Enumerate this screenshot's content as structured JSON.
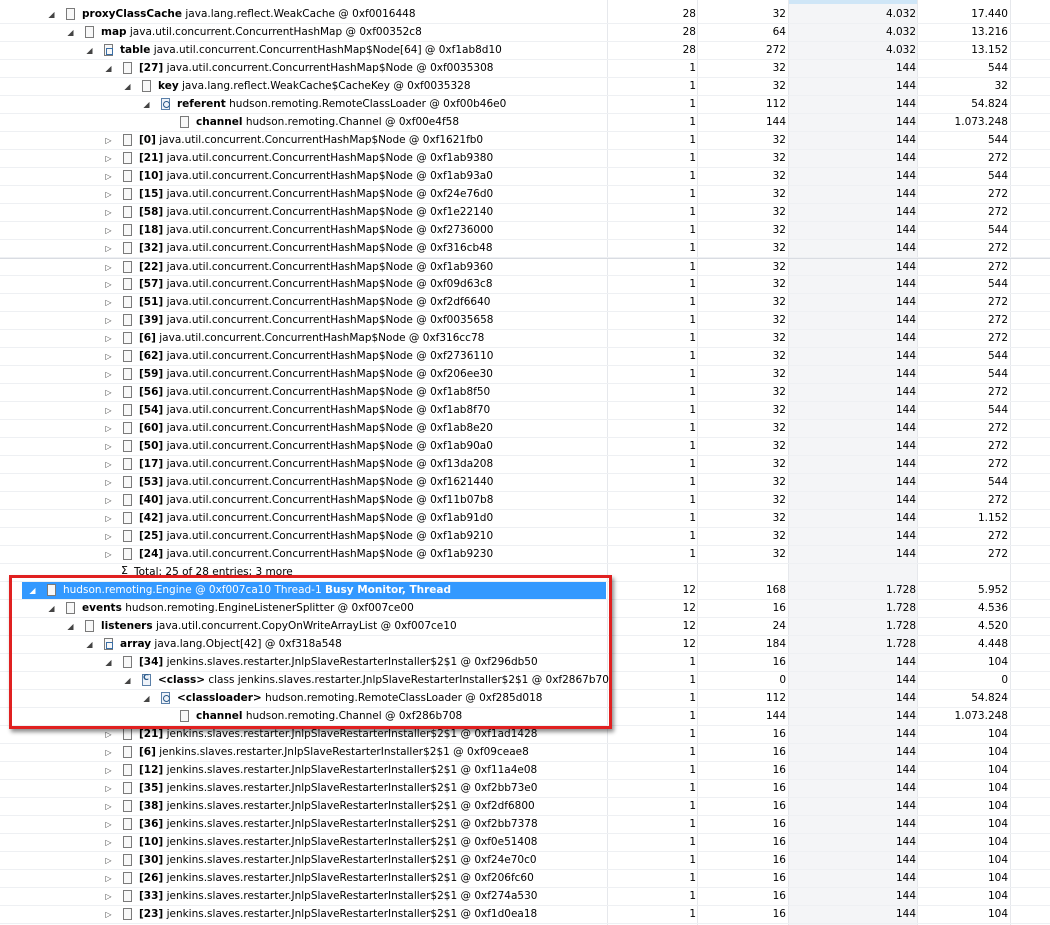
{
  "rows": [
    {
      "indent": 2,
      "twisty": "expanded",
      "icon": "doc",
      "field": "proxyClassCache",
      "type": "java.lang.reflect.WeakCache @ 0xf0016448",
      "c1": "28",
      "c2": "32",
      "c3": "4.032",
      "c4": "17.440"
    },
    {
      "indent": 3,
      "twisty": "expanded",
      "icon": "doc",
      "field": "map",
      "type": "java.util.concurrent.ConcurrentHashMap @ 0xf00352c8",
      "c1": "28",
      "c2": "64",
      "c3": "4.032",
      "c4": "13.216"
    },
    {
      "indent": 4,
      "twisty": "expanded",
      "icon": "arr",
      "field": "table",
      "type": "java.util.concurrent.ConcurrentHashMap$Node[64] @ 0xf1ab8d10",
      "c1": "28",
      "c2": "272",
      "c3": "4.032",
      "c4": "13.152"
    },
    {
      "indent": 5,
      "twisty": "expanded",
      "icon": "doc",
      "field": "[27]",
      "type": "java.util.concurrent.ConcurrentHashMap$Node @ 0xf0035308",
      "c1": "1",
      "c2": "32",
      "c3": "144",
      "c4": "544"
    },
    {
      "indent": 6,
      "twisty": "expanded",
      "icon": "doc",
      "field": "key",
      "type": "java.lang.reflect.WeakCache$CacheKey @ 0xf0035328",
      "c1": "1",
      "c2": "32",
      "c3": "144",
      "c4": "32"
    },
    {
      "indent": 7,
      "twisty": "expanded",
      "icon": "ldr",
      "field": "referent",
      "type": "hudson.remoting.RemoteClassLoader @ 0xf00b46e0",
      "c1": "1",
      "c2": "112",
      "c3": "144",
      "c4": "54.824"
    },
    {
      "indent": 8,
      "twisty": "none",
      "icon": "doc",
      "field": "channel",
      "type": "hudson.remoting.Channel @ 0xf00e4f58",
      "c1": "1",
      "c2": "144",
      "c3": "144",
      "c4": "1.073.248"
    },
    {
      "indent": 5,
      "twisty": "collapsed",
      "icon": "doc",
      "field": "[0]",
      "type": "java.util.concurrent.ConcurrentHashMap$Node @ 0xf1621fb0",
      "c1": "1",
      "c2": "32",
      "c3": "144",
      "c4": "544"
    },
    {
      "indent": 5,
      "twisty": "collapsed",
      "icon": "doc",
      "field": "[21]",
      "type": "java.util.concurrent.ConcurrentHashMap$Node @ 0xf1ab9380",
      "c1": "1",
      "c2": "32",
      "c3": "144",
      "c4": "272"
    },
    {
      "indent": 5,
      "twisty": "collapsed",
      "icon": "doc",
      "field": "[10]",
      "type": "java.util.concurrent.ConcurrentHashMap$Node @ 0xf1ab93a0",
      "c1": "1",
      "c2": "32",
      "c3": "144",
      "c4": "544"
    },
    {
      "indent": 5,
      "twisty": "collapsed",
      "icon": "doc",
      "field": "[15]",
      "type": "java.util.concurrent.ConcurrentHashMap$Node @ 0xf24e76d0",
      "c1": "1",
      "c2": "32",
      "c3": "144",
      "c4": "272"
    },
    {
      "indent": 5,
      "twisty": "collapsed",
      "icon": "doc",
      "field": "[58]",
      "type": "java.util.concurrent.ConcurrentHashMap$Node @ 0xf1e22140",
      "c1": "1",
      "c2": "32",
      "c3": "144",
      "c4": "272"
    },
    {
      "indent": 5,
      "twisty": "collapsed",
      "icon": "doc",
      "field": "[18]",
      "type": "java.util.concurrent.ConcurrentHashMap$Node @ 0xf2736000",
      "c1": "1",
      "c2": "32",
      "c3": "144",
      "c4": "544"
    },
    {
      "indent": 5,
      "twisty": "collapsed",
      "icon": "doc",
      "field": "[32]",
      "type": "java.util.concurrent.ConcurrentHashMap$Node @ 0xf316cb48",
      "c1": "1",
      "c2": "32",
      "c3": "144",
      "c4": "272"
    },
    {
      "indent": 5,
      "twisty": "collapsed",
      "icon": "doc",
      "field": "[22]",
      "type": "java.util.concurrent.ConcurrentHashMap$Node @ 0xf1ab9360",
      "c1": "1",
      "c2": "32",
      "c3": "144",
      "c4": "272",
      "hl": true
    },
    {
      "indent": 5,
      "twisty": "collapsed",
      "icon": "doc",
      "field": "[57]",
      "type": "java.util.concurrent.ConcurrentHashMap$Node @ 0xf09d63c8",
      "c1": "1",
      "c2": "32",
      "c3": "144",
      "c4": "544"
    },
    {
      "indent": 5,
      "twisty": "collapsed",
      "icon": "doc",
      "field": "[51]",
      "type": "java.util.concurrent.ConcurrentHashMap$Node @ 0xf2df6640",
      "c1": "1",
      "c2": "32",
      "c3": "144",
      "c4": "272"
    },
    {
      "indent": 5,
      "twisty": "collapsed",
      "icon": "doc",
      "field": "[39]",
      "type": "java.util.concurrent.ConcurrentHashMap$Node @ 0xf0035658",
      "c1": "1",
      "c2": "32",
      "c3": "144",
      "c4": "272"
    },
    {
      "indent": 5,
      "twisty": "collapsed",
      "icon": "doc",
      "field": "[6]",
      "type": "java.util.concurrent.ConcurrentHashMap$Node @ 0xf316cc78",
      "c1": "1",
      "c2": "32",
      "c3": "144",
      "c4": "272"
    },
    {
      "indent": 5,
      "twisty": "collapsed",
      "icon": "doc",
      "field": "[62]",
      "type": "java.util.concurrent.ConcurrentHashMap$Node @ 0xf2736110",
      "c1": "1",
      "c2": "32",
      "c3": "144",
      "c4": "544"
    },
    {
      "indent": 5,
      "twisty": "collapsed",
      "icon": "doc",
      "field": "[59]",
      "type": "java.util.concurrent.ConcurrentHashMap$Node @ 0xf206ee30",
      "c1": "1",
      "c2": "32",
      "c3": "144",
      "c4": "544"
    },
    {
      "indent": 5,
      "twisty": "collapsed",
      "icon": "doc",
      "field": "[56]",
      "type": "java.util.concurrent.ConcurrentHashMap$Node @ 0xf1ab8f50",
      "c1": "1",
      "c2": "32",
      "c3": "144",
      "c4": "272"
    },
    {
      "indent": 5,
      "twisty": "collapsed",
      "icon": "doc",
      "field": "[54]",
      "type": "java.util.concurrent.ConcurrentHashMap$Node @ 0xf1ab8f70",
      "c1": "1",
      "c2": "32",
      "c3": "144",
      "c4": "544"
    },
    {
      "indent": 5,
      "twisty": "collapsed",
      "icon": "doc",
      "field": "[60]",
      "type": "java.util.concurrent.ConcurrentHashMap$Node @ 0xf1ab8e20",
      "c1": "1",
      "c2": "32",
      "c3": "144",
      "c4": "272"
    },
    {
      "indent": 5,
      "twisty": "collapsed",
      "icon": "doc",
      "field": "[50]",
      "type": "java.util.concurrent.ConcurrentHashMap$Node @ 0xf1ab90a0",
      "c1": "1",
      "c2": "32",
      "c3": "144",
      "c4": "272"
    },
    {
      "indent": 5,
      "twisty": "collapsed",
      "icon": "doc",
      "field": "[17]",
      "type": "java.util.concurrent.ConcurrentHashMap$Node @ 0xf13da208",
      "c1": "1",
      "c2": "32",
      "c3": "144",
      "c4": "272"
    },
    {
      "indent": 5,
      "twisty": "collapsed",
      "icon": "doc",
      "field": "[53]",
      "type": "java.util.concurrent.ConcurrentHashMap$Node @ 0xf1621440",
      "c1": "1",
      "c2": "32",
      "c3": "144",
      "c4": "544"
    },
    {
      "indent": 5,
      "twisty": "collapsed",
      "icon": "doc",
      "field": "[40]",
      "type": "java.util.concurrent.ConcurrentHashMap$Node @ 0xf11b07b8",
      "c1": "1",
      "c2": "32",
      "c3": "144",
      "c4": "272"
    },
    {
      "indent": 5,
      "twisty": "collapsed",
      "icon": "doc",
      "field": "[42]",
      "type": "java.util.concurrent.ConcurrentHashMap$Node @ 0xf1ab91d0",
      "c1": "1",
      "c2": "32",
      "c3": "144",
      "c4": "1.152"
    },
    {
      "indent": 5,
      "twisty": "collapsed",
      "icon": "doc",
      "field": "[25]",
      "type": "java.util.concurrent.ConcurrentHashMap$Node @ 0xf1ab9210",
      "c1": "1",
      "c2": "32",
      "c3": "144",
      "c4": "272"
    },
    {
      "indent": 5,
      "twisty": "collapsed",
      "icon": "doc",
      "field": "[24]",
      "type": "java.util.concurrent.ConcurrentHashMap$Node @ 0xf1ab9230",
      "c1": "1",
      "c2": "32",
      "c3": "144",
      "c4": "272"
    },
    {
      "indent": 5,
      "twisty": "none",
      "icon": "sigma",
      "field": "",
      "type": "Total: 25 of 28 entries; 3 more",
      "c1": "",
      "c2": "",
      "c3": "",
      "c4": ""
    },
    {
      "indent": 1,
      "twisty": "expanded",
      "icon": "doc",
      "field": "",
      "type": "hudson.remoting.Engine @ 0xf007ca10  Thread-1",
      "bold_suffix": "Busy Monitor, Thread",
      "c1": "12",
      "c2": "168",
      "c3": "1.728",
      "c4": "5.952",
      "selected": true
    },
    {
      "indent": 2,
      "twisty": "expanded",
      "icon": "doc",
      "field": "events",
      "type": "hudson.remoting.EngineListenerSplitter @ 0xf007ce00",
      "c1": "12",
      "c2": "16",
      "c3": "1.728",
      "c4": "4.536"
    },
    {
      "indent": 3,
      "twisty": "expanded",
      "icon": "doc",
      "field": "listeners",
      "type": "java.util.concurrent.CopyOnWriteArrayList @ 0xf007ce10",
      "c1": "12",
      "c2": "24",
      "c3": "1.728",
      "c4": "4.520"
    },
    {
      "indent": 4,
      "twisty": "expanded",
      "icon": "arr",
      "field": "array",
      "type": "java.lang.Object[42] @ 0xf318a548",
      "c1": "12",
      "c2": "184",
      "c3": "1.728",
      "c4": "4.448"
    },
    {
      "indent": 5,
      "twisty": "expanded",
      "icon": "doc",
      "field": "[34]",
      "type": "jenkins.slaves.restarter.JnlpSlaveRestarterInstaller$2$1 @ 0xf296db50",
      "c1": "1",
      "c2": "16",
      "c3": "144",
      "c4": "104"
    },
    {
      "indent": 6,
      "twisty": "expanded",
      "icon": "cls",
      "field": "<class>",
      "type": "class jenkins.slaves.restarter.JnlpSlaveRestarterInstaller$2$1 @ 0xf2867b70",
      "c1": "1",
      "c2": "0",
      "c3": "144",
      "c4": "0"
    },
    {
      "indent": 7,
      "twisty": "expanded",
      "icon": "ldr",
      "field": "<classloader>",
      "type": "hudson.remoting.RemoteClassLoader @ 0xf285d018",
      "c1": "1",
      "c2": "112",
      "c3": "144",
      "c4": "54.824"
    },
    {
      "indent": 8,
      "twisty": "none",
      "icon": "doc",
      "field": "channel",
      "type": "hudson.remoting.Channel @ 0xf286b708",
      "c1": "1",
      "c2": "144",
      "c3": "144",
      "c4": "1.073.248"
    },
    {
      "indent": 5,
      "twisty": "collapsed",
      "icon": "doc",
      "field": "[21]",
      "type": "jenkins.slaves.restarter.JnlpSlaveRestarterInstaller$2$1 @ 0xf1ad1428",
      "c1": "1",
      "c2": "16",
      "c3": "144",
      "c4": "104"
    },
    {
      "indent": 5,
      "twisty": "collapsed",
      "icon": "doc",
      "field": "[6]",
      "type": "jenkins.slaves.restarter.JnlpSlaveRestarterInstaller$2$1 @ 0xf09ceae8",
      "c1": "1",
      "c2": "16",
      "c3": "144",
      "c4": "104"
    },
    {
      "indent": 5,
      "twisty": "collapsed",
      "icon": "doc",
      "field": "[12]",
      "type": "jenkins.slaves.restarter.JnlpSlaveRestarterInstaller$2$1 @ 0xf11a4e08",
      "c1": "1",
      "c2": "16",
      "c3": "144",
      "c4": "104"
    },
    {
      "indent": 5,
      "twisty": "collapsed",
      "icon": "doc",
      "field": "[35]",
      "type": "jenkins.slaves.restarter.JnlpSlaveRestarterInstaller$2$1 @ 0xf2bb73e0",
      "c1": "1",
      "c2": "16",
      "c3": "144",
      "c4": "104"
    },
    {
      "indent": 5,
      "twisty": "collapsed",
      "icon": "doc",
      "field": "[38]",
      "type": "jenkins.slaves.restarter.JnlpSlaveRestarterInstaller$2$1 @ 0xf2df6800",
      "c1": "1",
      "c2": "16",
      "c3": "144",
      "c4": "104"
    },
    {
      "indent": 5,
      "twisty": "collapsed",
      "icon": "doc",
      "field": "[36]",
      "type": "jenkins.slaves.restarter.JnlpSlaveRestarterInstaller$2$1 @ 0xf2bb7378",
      "c1": "1",
      "c2": "16",
      "c3": "144",
      "c4": "104"
    },
    {
      "indent": 5,
      "twisty": "collapsed",
      "icon": "doc",
      "field": "[10]",
      "type": "jenkins.slaves.restarter.JnlpSlaveRestarterInstaller$2$1 @ 0xf0e51408",
      "c1": "1",
      "c2": "16",
      "c3": "144",
      "c4": "104"
    },
    {
      "indent": 5,
      "twisty": "collapsed",
      "icon": "doc",
      "field": "[30]",
      "type": "jenkins.slaves.restarter.JnlpSlaveRestarterInstaller$2$1 @ 0xf24e70c0",
      "c1": "1",
      "c2": "16",
      "c3": "144",
      "c4": "104"
    },
    {
      "indent": 5,
      "twisty": "collapsed",
      "icon": "doc",
      "field": "[26]",
      "type": "jenkins.slaves.restarter.JnlpSlaveRestarterInstaller$2$1 @ 0xf206fc60",
      "c1": "1",
      "c2": "16",
      "c3": "144",
      "c4": "104"
    },
    {
      "indent": 5,
      "twisty": "collapsed",
      "icon": "doc",
      "field": "[33]",
      "type": "jenkins.slaves.restarter.JnlpSlaveRestarterInstaller$2$1 @ 0xf274a530",
      "c1": "1",
      "c2": "16",
      "c3": "144",
      "c4": "104"
    },
    {
      "indent": 5,
      "twisty": "collapsed",
      "icon": "doc",
      "field": "[23]",
      "type": "jenkins.slaves.restarter.JnlpSlaveRestarterInstaller$2$1 @ 0xf1d0ea18",
      "c1": "1",
      "c2": "16",
      "c3": "144",
      "c4": "104"
    }
  ],
  "colors": {
    "selection": "#3399ff",
    "highlight_box": "#e02020",
    "sorted_column_shade": "#f4f5f7"
  }
}
